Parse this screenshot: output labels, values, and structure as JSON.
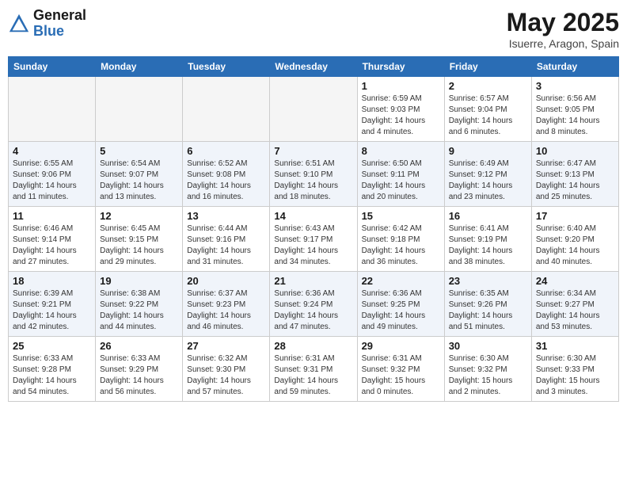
{
  "header": {
    "logo_general": "General",
    "logo_blue": "Blue",
    "month": "May 2025",
    "location": "Isuerre, Aragon, Spain"
  },
  "weekdays": [
    "Sunday",
    "Monday",
    "Tuesday",
    "Wednesday",
    "Thursday",
    "Friday",
    "Saturday"
  ],
  "weeks": [
    [
      {
        "day": "",
        "info": ""
      },
      {
        "day": "",
        "info": ""
      },
      {
        "day": "",
        "info": ""
      },
      {
        "day": "",
        "info": ""
      },
      {
        "day": "1",
        "info": "Sunrise: 6:59 AM\nSunset: 9:03 PM\nDaylight: 14 hours\nand 4 minutes."
      },
      {
        "day": "2",
        "info": "Sunrise: 6:57 AM\nSunset: 9:04 PM\nDaylight: 14 hours\nand 6 minutes."
      },
      {
        "day": "3",
        "info": "Sunrise: 6:56 AM\nSunset: 9:05 PM\nDaylight: 14 hours\nand 8 minutes."
      }
    ],
    [
      {
        "day": "4",
        "info": "Sunrise: 6:55 AM\nSunset: 9:06 PM\nDaylight: 14 hours\nand 11 minutes."
      },
      {
        "day": "5",
        "info": "Sunrise: 6:54 AM\nSunset: 9:07 PM\nDaylight: 14 hours\nand 13 minutes."
      },
      {
        "day": "6",
        "info": "Sunrise: 6:52 AM\nSunset: 9:08 PM\nDaylight: 14 hours\nand 16 minutes."
      },
      {
        "day": "7",
        "info": "Sunrise: 6:51 AM\nSunset: 9:10 PM\nDaylight: 14 hours\nand 18 minutes."
      },
      {
        "day": "8",
        "info": "Sunrise: 6:50 AM\nSunset: 9:11 PM\nDaylight: 14 hours\nand 20 minutes."
      },
      {
        "day": "9",
        "info": "Sunrise: 6:49 AM\nSunset: 9:12 PM\nDaylight: 14 hours\nand 23 minutes."
      },
      {
        "day": "10",
        "info": "Sunrise: 6:47 AM\nSunset: 9:13 PM\nDaylight: 14 hours\nand 25 minutes."
      }
    ],
    [
      {
        "day": "11",
        "info": "Sunrise: 6:46 AM\nSunset: 9:14 PM\nDaylight: 14 hours\nand 27 minutes."
      },
      {
        "day": "12",
        "info": "Sunrise: 6:45 AM\nSunset: 9:15 PM\nDaylight: 14 hours\nand 29 minutes."
      },
      {
        "day": "13",
        "info": "Sunrise: 6:44 AM\nSunset: 9:16 PM\nDaylight: 14 hours\nand 31 minutes."
      },
      {
        "day": "14",
        "info": "Sunrise: 6:43 AM\nSunset: 9:17 PM\nDaylight: 14 hours\nand 34 minutes."
      },
      {
        "day": "15",
        "info": "Sunrise: 6:42 AM\nSunset: 9:18 PM\nDaylight: 14 hours\nand 36 minutes."
      },
      {
        "day": "16",
        "info": "Sunrise: 6:41 AM\nSunset: 9:19 PM\nDaylight: 14 hours\nand 38 minutes."
      },
      {
        "day": "17",
        "info": "Sunrise: 6:40 AM\nSunset: 9:20 PM\nDaylight: 14 hours\nand 40 minutes."
      }
    ],
    [
      {
        "day": "18",
        "info": "Sunrise: 6:39 AM\nSunset: 9:21 PM\nDaylight: 14 hours\nand 42 minutes."
      },
      {
        "day": "19",
        "info": "Sunrise: 6:38 AM\nSunset: 9:22 PM\nDaylight: 14 hours\nand 44 minutes."
      },
      {
        "day": "20",
        "info": "Sunrise: 6:37 AM\nSunset: 9:23 PM\nDaylight: 14 hours\nand 46 minutes."
      },
      {
        "day": "21",
        "info": "Sunrise: 6:36 AM\nSunset: 9:24 PM\nDaylight: 14 hours\nand 47 minutes."
      },
      {
        "day": "22",
        "info": "Sunrise: 6:36 AM\nSunset: 9:25 PM\nDaylight: 14 hours\nand 49 minutes."
      },
      {
        "day": "23",
        "info": "Sunrise: 6:35 AM\nSunset: 9:26 PM\nDaylight: 14 hours\nand 51 minutes."
      },
      {
        "day": "24",
        "info": "Sunrise: 6:34 AM\nSunset: 9:27 PM\nDaylight: 14 hours\nand 53 minutes."
      }
    ],
    [
      {
        "day": "25",
        "info": "Sunrise: 6:33 AM\nSunset: 9:28 PM\nDaylight: 14 hours\nand 54 minutes."
      },
      {
        "day": "26",
        "info": "Sunrise: 6:33 AM\nSunset: 9:29 PM\nDaylight: 14 hours\nand 56 minutes."
      },
      {
        "day": "27",
        "info": "Sunrise: 6:32 AM\nSunset: 9:30 PM\nDaylight: 14 hours\nand 57 minutes."
      },
      {
        "day": "28",
        "info": "Sunrise: 6:31 AM\nSunset: 9:31 PM\nDaylight: 14 hours\nand 59 minutes."
      },
      {
        "day": "29",
        "info": "Sunrise: 6:31 AM\nSunset: 9:32 PM\nDaylight: 15 hours\nand 0 minutes."
      },
      {
        "day": "30",
        "info": "Sunrise: 6:30 AM\nSunset: 9:32 PM\nDaylight: 15 hours\nand 2 minutes."
      },
      {
        "day": "31",
        "info": "Sunrise: 6:30 AM\nSunset: 9:33 PM\nDaylight: 15 hours\nand 3 minutes."
      }
    ]
  ]
}
